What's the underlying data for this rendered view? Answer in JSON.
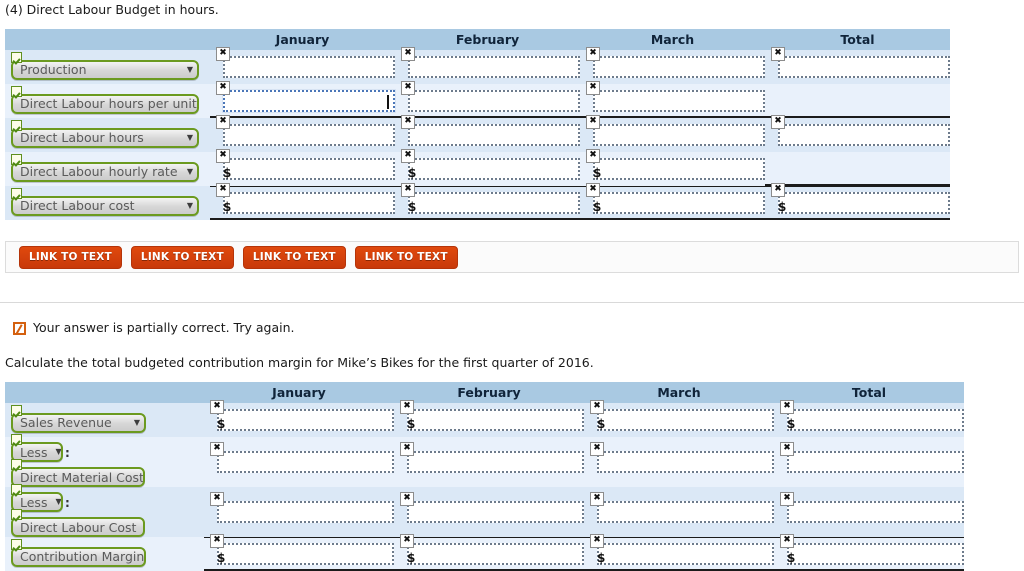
{
  "colors": {
    "header_bg": "#a9c9e2",
    "row_a": "#dbe8f6",
    "row_b": "#e9f1fb",
    "dropdown_border": "#6b9a1f",
    "link_button": "#d8450c",
    "partial_icon": "#d4600f"
  },
  "section_top": {
    "prompt": "(4) Direct Labour Budget in hours.",
    "columns": [
      "",
      "January",
      "February",
      "March",
      "Total"
    ],
    "rows": [
      {
        "label": "Production",
        "icon": "checkmark-badge",
        "cells": [
          {
            "has_input": true,
            "dollar": false,
            "focused": false,
            "value": ""
          },
          {
            "has_input": true,
            "dollar": false,
            "focused": false,
            "value": ""
          },
          {
            "has_input": true,
            "dollar": false,
            "focused": false,
            "value": ""
          },
          {
            "has_input": true,
            "dollar": false,
            "focused": false,
            "value": ""
          }
        ]
      },
      {
        "label": "Direct Labour hours per unit",
        "icon": "checkmark-badge",
        "cells": [
          {
            "has_input": true,
            "dollar": false,
            "focused": true,
            "value": ""
          },
          {
            "has_input": true,
            "dollar": false,
            "focused": false,
            "value": ""
          },
          {
            "has_input": true,
            "dollar": false,
            "focused": false,
            "value": ""
          },
          {
            "has_input": false,
            "dollar": false,
            "focused": false,
            "value": ""
          }
        ]
      },
      {
        "label": "Direct Labour hours",
        "icon": "checkmark-badge",
        "cells": [
          {
            "has_input": true,
            "dollar": false,
            "focused": false,
            "value": ""
          },
          {
            "has_input": true,
            "dollar": false,
            "focused": false,
            "value": ""
          },
          {
            "has_input": true,
            "dollar": false,
            "focused": false,
            "value": ""
          },
          {
            "has_input": true,
            "dollar": false,
            "focused": false,
            "value": ""
          }
        ]
      },
      {
        "label": "Direct Labour hourly rate",
        "icon": "checkmark-badge",
        "cells": [
          {
            "has_input": true,
            "dollar": true,
            "focused": false,
            "value": ""
          },
          {
            "has_input": true,
            "dollar": true,
            "focused": false,
            "value": ""
          },
          {
            "has_input": true,
            "dollar": true,
            "focused": false,
            "value": ""
          },
          {
            "has_input": false,
            "dollar": false,
            "focused": false,
            "value": ""
          }
        ]
      },
      {
        "label": "Direct Labour cost",
        "icon": "checkmark-badge",
        "cells": [
          {
            "has_input": true,
            "dollar": true,
            "focused": false,
            "value": ""
          },
          {
            "has_input": true,
            "dollar": true,
            "focused": false,
            "value": ""
          },
          {
            "has_input": true,
            "dollar": true,
            "focused": false,
            "value": ""
          },
          {
            "has_input": true,
            "dollar": true,
            "focused": false,
            "value": ""
          }
        ]
      }
    ]
  },
  "link_bar": {
    "buttons": [
      "LINK TO TEXT",
      "LINK TO TEXT",
      "LINK TO TEXT",
      "LINK TO TEXT"
    ]
  },
  "feedback": {
    "icon": "partially-correct-icon",
    "text": "Your answer is partially correct.  Try again."
  },
  "section_bottom": {
    "prompt": "Calculate the total budgeted contribution margin for Mike’s Bikes for the first quarter of 2016.",
    "columns": [
      "",
      "January",
      "February",
      "March",
      "Total"
    ],
    "rows": [
      {
        "prefix": null,
        "separator": null,
        "label": "Sales Revenue",
        "icon": "checkmark-badge",
        "cells": [
          {
            "has_input": true,
            "dollar": true,
            "focused": false,
            "value": ""
          },
          {
            "has_input": true,
            "dollar": true,
            "focused": false,
            "value": ""
          },
          {
            "has_input": true,
            "dollar": true,
            "focused": false,
            "value": ""
          },
          {
            "has_input": true,
            "dollar": true,
            "focused": false,
            "value": ""
          }
        ]
      },
      {
        "prefix": "Less",
        "separator": ":",
        "label": "Direct Material Cost",
        "icon": "checkmark-badge",
        "cells": [
          {
            "has_input": true,
            "dollar": false,
            "focused": false,
            "value": ""
          },
          {
            "has_input": true,
            "dollar": false,
            "focused": false,
            "value": ""
          },
          {
            "has_input": true,
            "dollar": false,
            "focused": false,
            "value": ""
          },
          {
            "has_input": true,
            "dollar": false,
            "focused": false,
            "value": ""
          }
        ]
      },
      {
        "prefix": "Less",
        "separator": ":",
        "label": "Direct Labour Cost",
        "icon": "checkmark-badge",
        "cells": [
          {
            "has_input": true,
            "dollar": false,
            "focused": false,
            "value": ""
          },
          {
            "has_input": true,
            "dollar": false,
            "focused": false,
            "value": ""
          },
          {
            "has_input": true,
            "dollar": false,
            "focused": false,
            "value": ""
          },
          {
            "has_input": true,
            "dollar": false,
            "focused": false,
            "value": ""
          }
        ]
      },
      {
        "prefix": null,
        "separator": null,
        "label": "Contribution Margin",
        "icon": "checkmark-badge",
        "cells": [
          {
            "has_input": true,
            "dollar": true,
            "focused": false,
            "value": ""
          },
          {
            "has_input": true,
            "dollar": true,
            "focused": false,
            "value": ""
          },
          {
            "has_input": true,
            "dollar": true,
            "focused": false,
            "value": ""
          },
          {
            "has_input": true,
            "dollar": true,
            "focused": false,
            "value": ""
          }
        ]
      }
    ]
  },
  "icons": {
    "caret_down": "▼",
    "clear_field": "✖"
  }
}
